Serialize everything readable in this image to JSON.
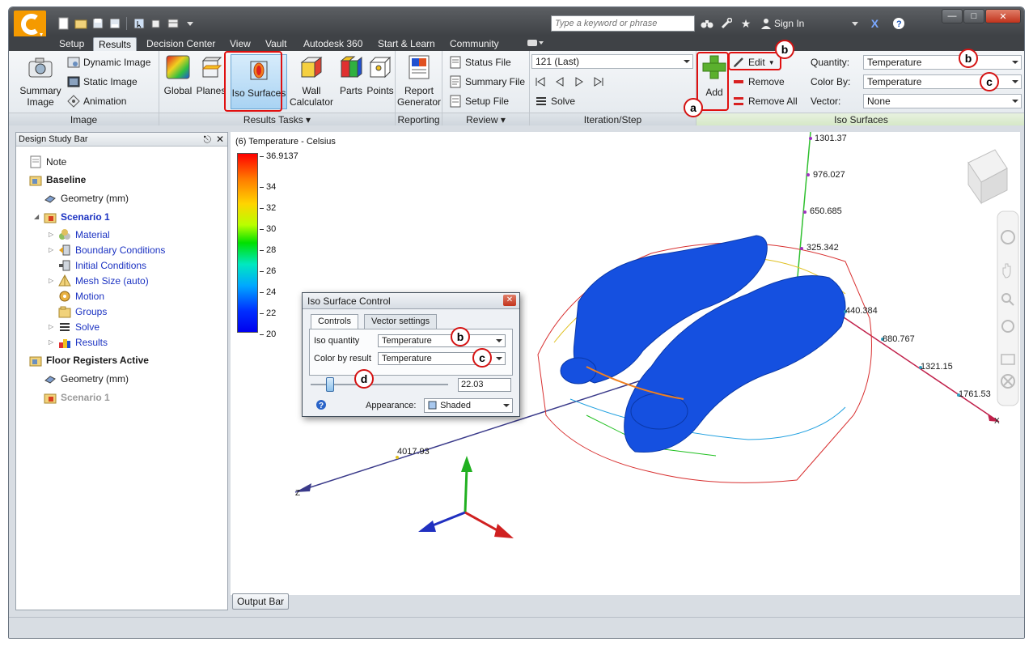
{
  "titlebar": {
    "search_placeholder": "Type a keyword or phrase",
    "sign_in": "Sign In"
  },
  "tabs": [
    "Setup",
    "Results",
    "Decision Center",
    "View",
    "Vault",
    "Autodesk 360",
    "Start & Learn",
    "Community"
  ],
  "ribbon": {
    "image_panel": {
      "label": "Image",
      "summary_image": "Summary Image",
      "dynamic_image": "Dynamic Image",
      "static_image": "Static Image",
      "animation": "Animation"
    },
    "results_tasks_panel": {
      "label": "Results Tasks",
      "global": "Global",
      "planes": "Planes",
      "iso_surfaces": "Iso Surfaces",
      "wall_calculator": "Wall Calculator",
      "parts": "Parts",
      "points": "Points"
    },
    "reporting_panel": {
      "label": "Reporting",
      "report_generator": "Report Generator"
    },
    "review_panel": {
      "label": "Review",
      "status_file": "Status File",
      "summary_file": "Summary File",
      "setup_file": "Setup File"
    },
    "iteration_panel": {
      "label": "Iteration/Step",
      "step_value": "121 (Last)",
      "solve": "Solve"
    },
    "iso_surfaces_panel": {
      "label": "Iso Surfaces",
      "add": "Add",
      "edit": "Edit",
      "remove": "Remove",
      "remove_all": "Remove All",
      "quantity_label": "Quantity:",
      "quantity_value": "Temperature",
      "color_by_label": "Color By:",
      "color_by_value": "Temperature",
      "vector_label": "Vector:",
      "vector_value": "None"
    }
  },
  "callouts": {
    "a": "a",
    "b": "b",
    "c": "c",
    "d": "d"
  },
  "design_study_bar": {
    "title": "Design Study Bar",
    "items": [
      {
        "label": "Note"
      },
      {
        "label": "Baseline"
      },
      {
        "label": "Geometry (mm)"
      },
      {
        "label": "Scenario 1"
      },
      {
        "label": "Material"
      },
      {
        "label": "Boundary Conditions"
      },
      {
        "label": "Initial Conditions"
      },
      {
        "label": "Mesh Size (auto)"
      },
      {
        "label": "Motion"
      },
      {
        "label": "Groups"
      },
      {
        "label": "Solve"
      },
      {
        "label": "Results"
      },
      {
        "label": "Floor Registers Active"
      },
      {
        "label": "Geometry (mm)"
      },
      {
        "label": "Scenario 1"
      }
    ]
  },
  "viewport": {
    "scale_title": "(6) Temperature - Celsius",
    "scale_ticks": [
      "36.9137",
      "34",
      "32",
      "30",
      "28",
      "26",
      "24",
      "22",
      "20"
    ],
    "axis_labels": [
      "1301.37",
      "976.027",
      "650.685",
      "325.342",
      "440.384",
      "880.767",
      "1321.15",
      "1761.53",
      "4017.93",
      "Z",
      "X"
    ]
  },
  "iso_dialog": {
    "title": "Iso Surface Control",
    "tab_controls": "Controls",
    "tab_vector": "Vector settings",
    "iso_quantity_label": "Iso quantity",
    "iso_quantity_value": "Temperature",
    "color_by_label": "Color by result",
    "color_by_value": "Temperature",
    "slider_value": "22.03",
    "slider_fraction": 0.12,
    "appearance_label": "Appearance:",
    "appearance_value": "Shaded"
  },
  "output_bar": "Output Bar",
  "colors": {
    "highlight": "#e01010",
    "iso_surface": "#1050e0",
    "accent": "#f5a000"
  }
}
